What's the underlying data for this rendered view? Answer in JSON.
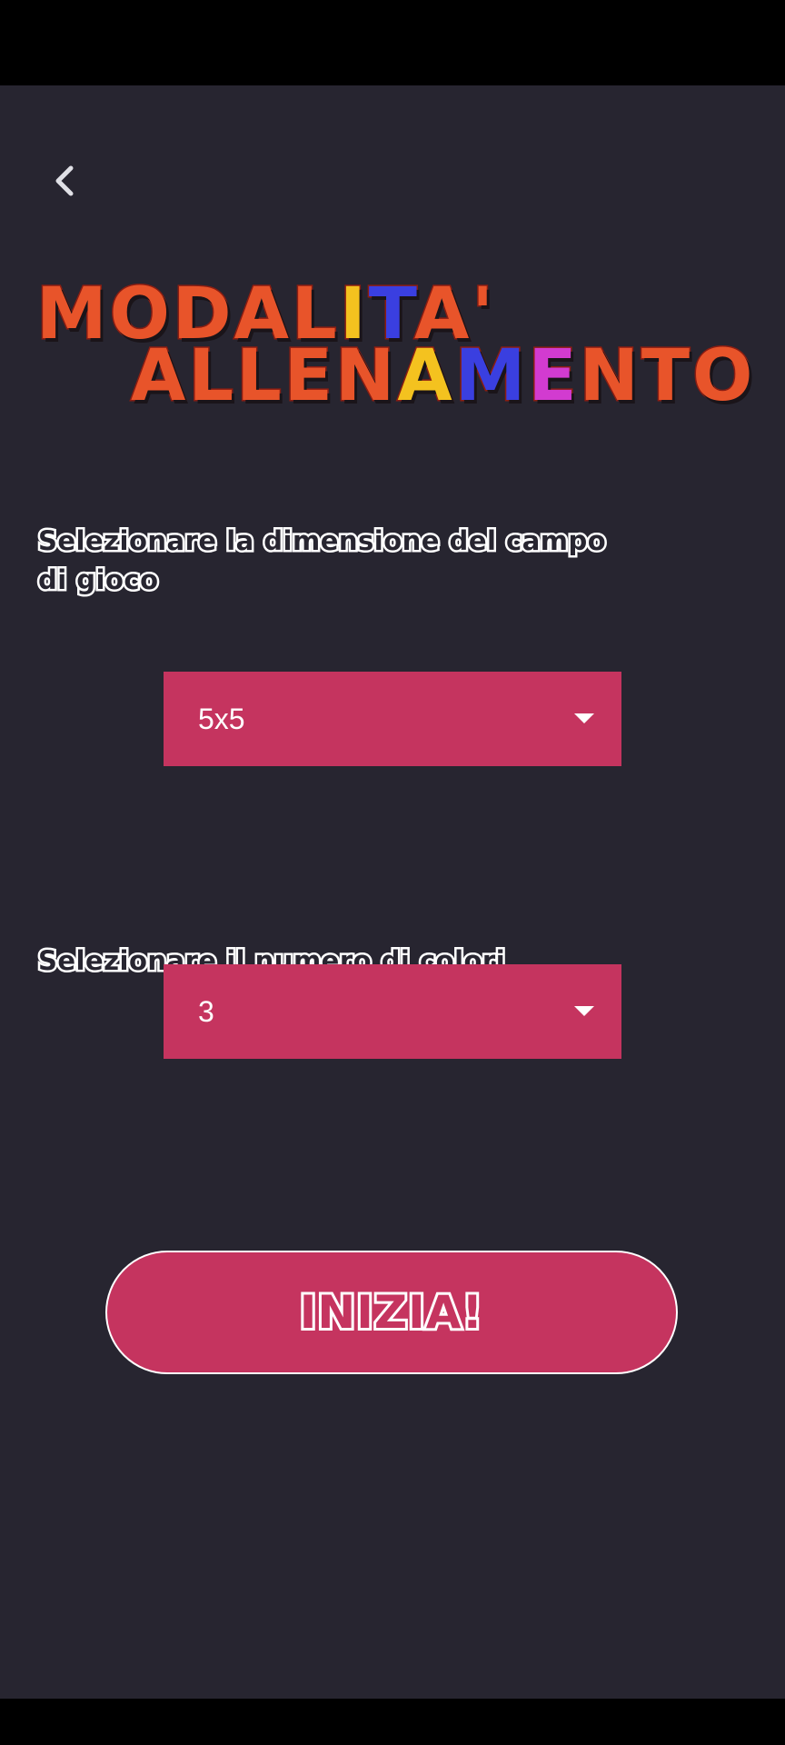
{
  "screen": {
    "title_line_1": [
      "MODALIT",
      "A",
      "'"
    ],
    "title_line_2": [
      "ALLEN",
      "A",
      "M",
      "ENTO"
    ],
    "title_text": "MODALITA' ALLENAMENTO"
  },
  "header": {
    "back_icon": "chevron-left-icon"
  },
  "board_size": {
    "label": "Selezionare la dimensione del campo di gioco",
    "selected": "5x5"
  },
  "color_count": {
    "label": "Selezionare il numero di colori",
    "selected": "3"
  },
  "start_button": {
    "label": "INIZIA!"
  },
  "colors": {
    "background": "#272530",
    "accent": "#c5345f",
    "title_orange": "#e8542a"
  }
}
